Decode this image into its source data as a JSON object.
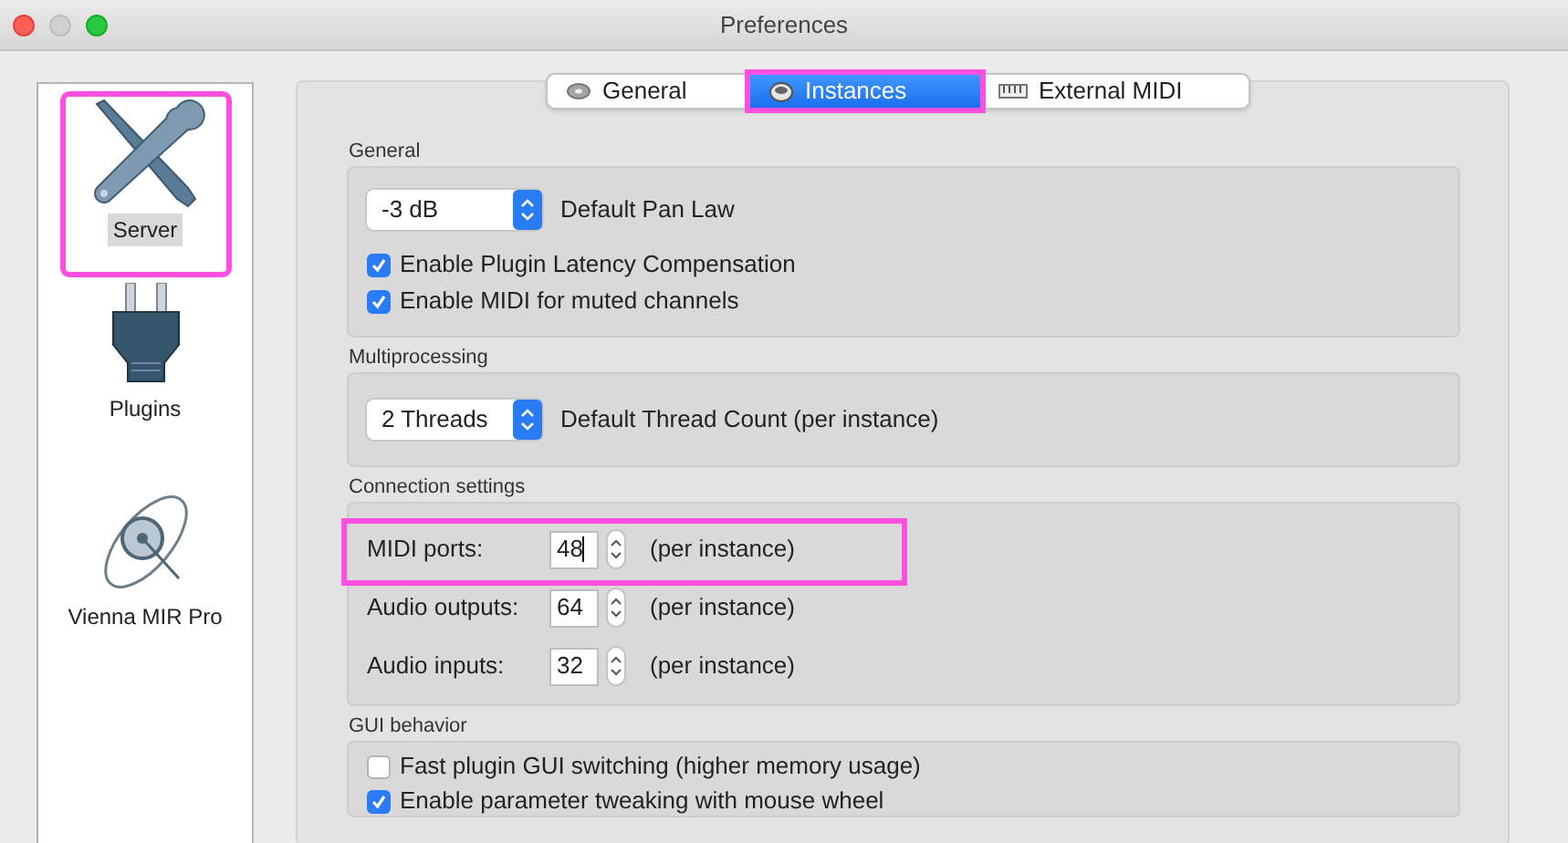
{
  "window": {
    "title": "Preferences"
  },
  "sidebar": {
    "items": [
      {
        "label": "Server",
        "selected": true,
        "highlighted": true
      },
      {
        "label": "Plugins",
        "selected": false,
        "highlighted": false
      },
      {
        "label": "Vienna MIR Pro",
        "selected": false,
        "highlighted": false
      }
    ]
  },
  "tabs": [
    {
      "label": "General",
      "selected": false,
      "highlighted": false
    },
    {
      "label": "Instances",
      "selected": true,
      "highlighted": true
    },
    {
      "label": "External MIDI",
      "selected": false,
      "highlighted": false
    }
  ],
  "sections": [
    {
      "title": "General",
      "rows": [
        {
          "kind": "dropdown",
          "selection": "-3 dB",
          "label": "Default Pan Law"
        },
        {
          "kind": "checkbox",
          "label": "Enable Plugin Latency Compensation",
          "checked": true
        },
        {
          "kind": "checkbox",
          "label": "Enable MIDI for muted channels",
          "checked": true
        }
      ]
    },
    {
      "title": "Multiprocessing",
      "rows": [
        {
          "kind": "dropdown",
          "selection": "2 Threads",
          "label": "Default Thread Count (per instance)"
        }
      ]
    },
    {
      "title": "Connection settings",
      "rows": [
        {
          "kind": "number",
          "label": "MIDI ports:",
          "value": "48",
          "note": "(per instance)",
          "focused": true,
          "highlighted": true
        },
        {
          "kind": "number",
          "label": "Audio outputs:",
          "value": "64",
          "note": "(per instance)",
          "focused": false,
          "highlighted": false
        },
        {
          "kind": "number",
          "label": "Audio inputs:",
          "value": "32",
          "note": "(per instance)",
          "focused": false,
          "highlighted": false
        }
      ]
    },
    {
      "title": "GUI behavior",
      "rows": [
        {
          "kind": "checkbox",
          "label": "Fast plugin GUI switching (higher memory usage)",
          "checked": false
        },
        {
          "kind": "checkbox",
          "label": "Enable parameter tweaking with mouse wheel",
          "checked": true
        }
      ]
    }
  ]
}
